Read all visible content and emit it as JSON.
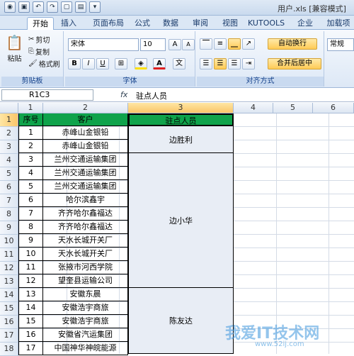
{
  "window": {
    "title": "用户.xls [兼容模式]"
  },
  "quick_access": [
    "save-icon",
    "undo-icon",
    "redo-icon",
    "new-icon",
    "print-icon",
    "dropdown-icon"
  ],
  "tabs": [
    "开始",
    "插入",
    "页面布局",
    "公式",
    "数据",
    "审阅",
    "视图",
    "KUTOOLS",
    "企业",
    "加载项"
  ],
  "ribbon": {
    "clipboard": {
      "paste": "粘贴",
      "cut": "剪切",
      "copy": "复制",
      "format_painter": "格式刷",
      "label": "剪贴板"
    },
    "font": {
      "name": "宋体",
      "size": "10",
      "bold": "B",
      "italic": "I",
      "underline": "U",
      "label": "字体",
      "grow": "A",
      "shrink": "A"
    },
    "alignment": {
      "wrap": "自动换行",
      "merge": "合并后居中",
      "label": "对齐方式"
    },
    "number": {
      "format": "常规"
    }
  },
  "formula_bar": {
    "name_box": "R1C3",
    "fx": "fx",
    "value": "驻点人员"
  },
  "columns": [
    "1",
    "2",
    "3",
    "4",
    "5",
    "6"
  ],
  "rows": [
    "1",
    "2",
    "3",
    "4",
    "5",
    "6",
    "7",
    "8",
    "9",
    "10",
    "11",
    "12",
    "13",
    "14",
    "15",
    "16",
    "17",
    "18"
  ],
  "table": {
    "headers": [
      "序号",
      "客户",
      "驻点人员"
    ],
    "rows": [
      [
        "1",
        "赤峰山金银铅"
      ],
      [
        "2",
        "赤峰山金银铅"
      ],
      [
        "3",
        "兰州交通运输集团"
      ],
      [
        "4",
        "兰州交通运输集团"
      ],
      [
        "5",
        "兰州交通运输集团"
      ],
      [
        "6",
        "哈尔滨鑫宇"
      ],
      [
        "7",
        "齐齐哈尔鑫福达"
      ],
      [
        "8",
        "齐齐哈尔鑫福达"
      ],
      [
        "9",
        "天水长城开关厂"
      ],
      [
        "10",
        "天水长城开关厂"
      ],
      [
        "11",
        "张掖市河西学院"
      ],
      [
        "12",
        "望奎县运输公司"
      ],
      [
        "13",
        "安徽东晨"
      ],
      [
        "14",
        "安徽浩宇商旅"
      ],
      [
        "15",
        "安徽浩宇商旅"
      ],
      [
        "16",
        "安徽省汽运集团"
      ],
      [
        "17",
        "中国神华神皖能源"
      ]
    ],
    "merged": [
      "边胜利",
      "边小华",
      "陈友达"
    ]
  },
  "watermark": {
    "text": "我爱IT技术网",
    "url": "www.52ij.com"
  },
  "colors": {
    "header_green": "#0fa34b",
    "merged_bg": "#e8edf5",
    "selection": "#f9c56a"
  }
}
